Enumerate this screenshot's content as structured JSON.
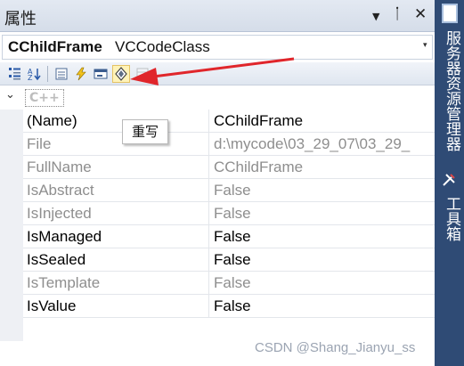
{
  "panel": {
    "title": "属性",
    "buttons": {
      "dropdown": "▼",
      "pin": "ᛙ",
      "close": "✕"
    }
  },
  "object_selector": {
    "name": "CChildFrame",
    "type": "VCCodeClass",
    "arrow": "▾"
  },
  "toolbar": {
    "icons": [
      "categorized-icon",
      "alphabetical-icon",
      "properties-icon",
      "events-icon",
      "messages-icon",
      "overrides-icon",
      "property-pages-icon"
    ],
    "tooltip": "重写"
  },
  "grid": {
    "category": {
      "label": "C++",
      "toggle": "⌄"
    },
    "rows": [
      {
        "name": "(Name)",
        "value": "CChildFrame",
        "readonly": false
      },
      {
        "name": "File",
        "value": "d:\\mycode\\03_29_07\\03_29_",
        "readonly": true
      },
      {
        "name": "FullName",
        "value": "CChildFrame",
        "readonly": true
      },
      {
        "name": "IsAbstract",
        "value": "False",
        "readonly": true
      },
      {
        "name": "IsInjected",
        "value": "False",
        "readonly": true
      },
      {
        "name": "IsManaged",
        "value": "False",
        "readonly": false
      },
      {
        "name": "IsSealed",
        "value": "False",
        "readonly": false
      },
      {
        "name": "IsTemplate",
        "value": "False",
        "readonly": true
      },
      {
        "name": "IsValue",
        "value": "False",
        "readonly": false
      }
    ]
  },
  "sidebar": {
    "tabs": [
      {
        "label": "服务器资源管理器",
        "icon": "server-explorer-icon"
      },
      {
        "label": "工具箱",
        "icon": "toolbox-icon"
      }
    ]
  },
  "annotation": {
    "arrow_color": "#e0262b"
  },
  "watermark": "CSDN @Shang_Jianyu_ss",
  "colors": {
    "readonly_text": "#8e8e8e",
    "editable_text": "#000000",
    "sidebar_bg": "#2f4b75",
    "selected_tool_bg": "#fff3b8"
  }
}
